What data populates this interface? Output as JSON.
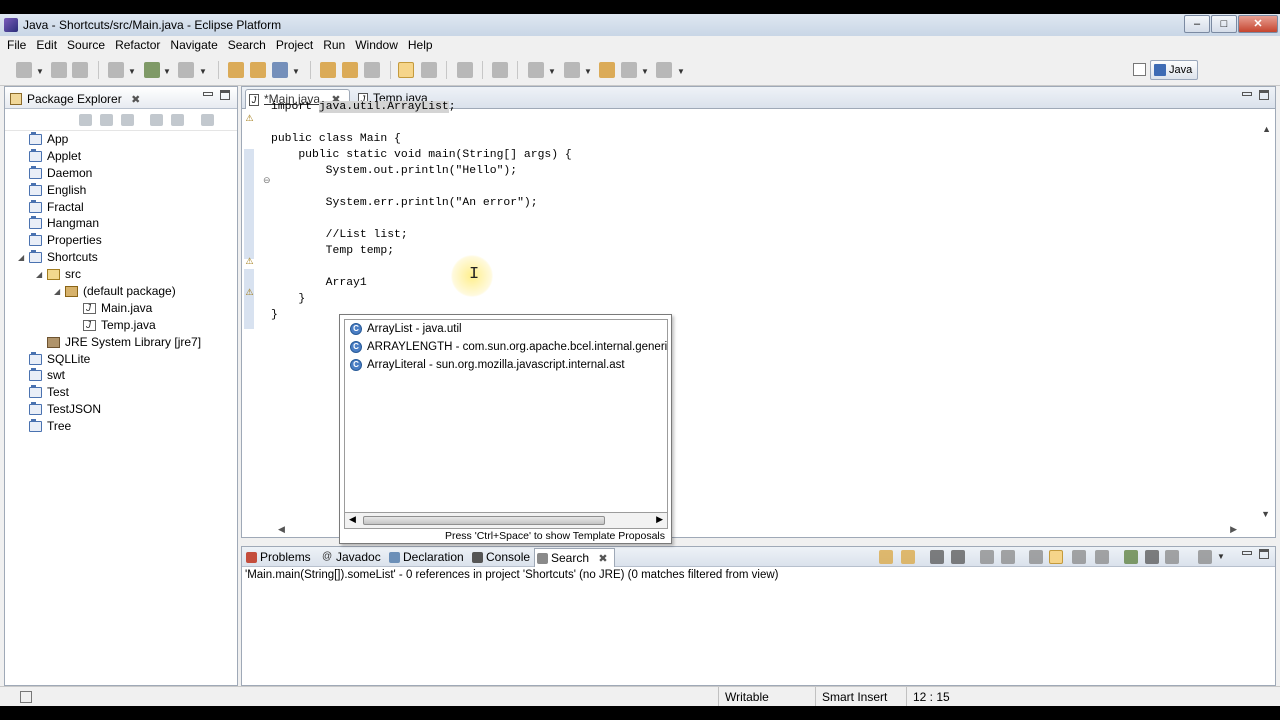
{
  "window": {
    "title": "Java - Shortcuts/src/Main.java - Eclipse Platform",
    "controls": [
      "minimize",
      "maximize",
      "close"
    ]
  },
  "menu": [
    "File",
    "Edit",
    "Source",
    "Refactor",
    "Navigate",
    "Search",
    "Project",
    "Run",
    "Window",
    "Help"
  ],
  "toolbar": {
    "perspective_label": "Java"
  },
  "package_explorer": {
    "title": "Package Explorer",
    "items": [
      {
        "label": "App",
        "type": "project",
        "indent": 0
      },
      {
        "label": "Applet",
        "type": "project",
        "indent": 0
      },
      {
        "label": "Daemon",
        "type": "project",
        "indent": 0
      },
      {
        "label": "English",
        "type": "project",
        "indent": 0
      },
      {
        "label": "Fractal",
        "type": "project",
        "indent": 0
      },
      {
        "label": "Hangman",
        "type": "project",
        "indent": 0
      },
      {
        "label": "Properties",
        "type": "project",
        "indent": 0
      },
      {
        "label": "Shortcuts",
        "type": "project",
        "indent": 0
      },
      {
        "label": "src",
        "type": "srcfolder",
        "indent": 1
      },
      {
        "label": "(default package)",
        "type": "package",
        "indent": 2
      },
      {
        "label": "Main.java",
        "type": "java",
        "indent": 3
      },
      {
        "label": "Temp.java",
        "type": "java",
        "indent": 3
      },
      {
        "label": "JRE System Library [jre7]",
        "type": "lib",
        "indent": 1
      },
      {
        "label": "SQLLite",
        "type": "project",
        "indent": 0
      },
      {
        "label": "swt",
        "type": "project",
        "indent": 0
      },
      {
        "label": "Test",
        "type": "project",
        "indent": 0
      },
      {
        "label": "TestJSON",
        "type": "project",
        "indent": 0
      },
      {
        "label": "Tree",
        "type": "project",
        "indent": 0
      }
    ]
  },
  "editor": {
    "tabs": [
      {
        "label": "*Main.java",
        "active": true
      },
      {
        "label": "Temp.java",
        "active": false
      }
    ],
    "code": {
      "line1_kw": "import ",
      "line1_hl": "java.util.ArrayList",
      "line1_end": ";",
      "line2": "public class Main {",
      "line3": "    public static void main(String[] args) {",
      "line4": "        System.out.println(\"Hello\");",
      "line5": "        System.err.println(\"An error\");",
      "line6": "        //List list;",
      "line7": "        Temp temp;",
      "line8": "        Array1",
      "line9": "    }",
      "line10": "}"
    }
  },
  "content_assist": {
    "proposals": [
      "ArrayList - java.util",
      "ARRAYLENGTH - com.sun.org.apache.bcel.internal.generic",
      "ArrayLiteral - sun.org.mozilla.javascript.internal.ast"
    ],
    "status": "Press 'Ctrl+Space' to show Template Proposals"
  },
  "bottom_panel": {
    "tabs": [
      "Problems",
      "Javadoc",
      "Declaration",
      "Console",
      "Search"
    ],
    "active_tab": "Search",
    "search_result": "'Main.main(String[]).someList' - 0 references in project 'Shortcuts' (no JRE) (0 matches filtered from view)"
  },
  "status_bar": {
    "writable": "Writable",
    "insert_mode": "Smart Insert",
    "position": "12 : 15"
  },
  "colors": {
    "accent": "#4a7ec4",
    "highlight": "#f6d58a"
  }
}
